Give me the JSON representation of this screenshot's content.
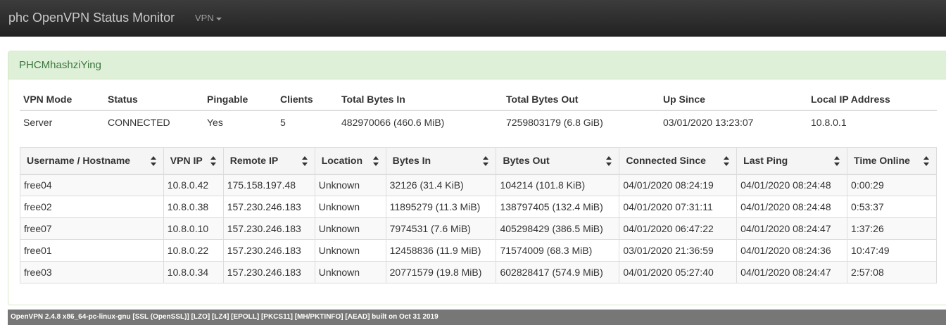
{
  "navbar": {
    "brand": "phc OpenVPN Status Monitor",
    "vpn_menu_label": "VPN"
  },
  "panel": {
    "title": "PHCMhashziYing"
  },
  "server_info": {
    "headers": [
      "VPN Mode",
      "Status",
      "Pingable",
      "Clients",
      "Total Bytes In",
      "Total Bytes Out",
      "Up Since",
      "Local IP Address"
    ],
    "values": [
      "Server",
      "CONNECTED",
      "Yes",
      "5",
      "482970066 (460.6 MiB)",
      "7259803179 (6.8 GiB)",
      "03/01/2020 13:23:07",
      "10.8.0.1"
    ]
  },
  "sessions": {
    "headers": [
      "Username / Hostname",
      "VPN IP",
      "Remote IP",
      "Location",
      "Bytes In",
      "Bytes Out",
      "Connected Since",
      "Last Ping",
      "Time Online"
    ],
    "rows": [
      [
        "free04",
        "10.8.0.42",
        "175.158.197.48",
        "Unknown",
        "32126 (31.4 KiB)",
        "104214 (101.8 KiB)",
        "04/01/2020 08:24:19",
        "04/01/2020 08:24:48",
        "0:00:29"
      ],
      [
        "free02",
        "10.8.0.38",
        "157.230.246.183",
        "Unknown",
        "11895279 (11.3 MiB)",
        "138797405 (132.4 MiB)",
        "04/01/2020 07:31:11",
        "04/01/2020 08:24:48",
        "0:53:37"
      ],
      [
        "free07",
        "10.8.0.10",
        "157.230.246.183",
        "Unknown",
        "7974531 (7.6 MiB)",
        "405298429 (386.5 MiB)",
        "04/01/2020 06:47:22",
        "04/01/2020 08:24:47",
        "1:37:26"
      ],
      [
        "free01",
        "10.8.0.22",
        "157.230.246.183",
        "Unknown",
        "12458836 (11.9 MiB)",
        "71574009 (68.3 MiB)",
        "03/01/2020 21:36:59",
        "04/01/2020 08:24:36",
        "10:47:49"
      ],
      [
        "free03",
        "10.8.0.34",
        "157.230.246.183",
        "Unknown",
        "20771579 (19.8 MiB)",
        "602828417 (574.9 MiB)",
        "04/01/2020 05:27:40",
        "04/01/2020 08:24:47",
        "2:57:08"
      ]
    ]
  },
  "footer": {
    "text": "OpenVPN 2.4.8 x86_64-pc-linux-gnu [SSL (OpenSSL)] [LZO] [LZ4] [EPOLL] [PKCS11] [MH/PKTINFO] [AEAD] built on Oct 31 2019"
  },
  "icons": {
    "sort": "sort-icon",
    "dropdown": "caret-down-icon"
  }
}
